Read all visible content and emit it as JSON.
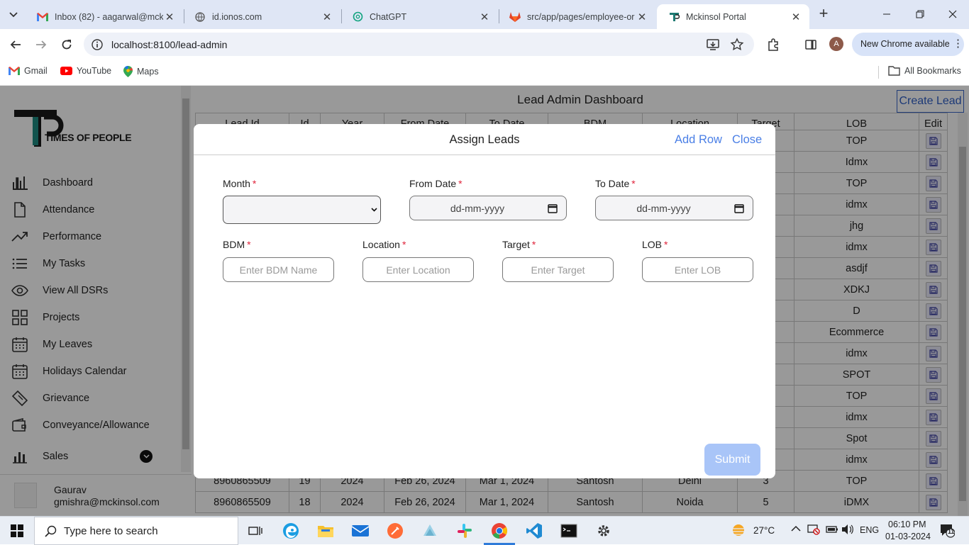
{
  "browser": {
    "tabs": [
      {
        "title": "Inbox (82) - aagarwal@mckin",
        "icon": "gmail-icon"
      },
      {
        "title": "id.ionos.com",
        "icon": "globe-icon"
      },
      {
        "title": "ChatGPT",
        "icon": "chatgpt-icon"
      },
      {
        "title": "src/app/pages/employee-or",
        "icon": "gitlab-icon"
      },
      {
        "title": "Mckinsol Portal",
        "icon": "portal-icon",
        "active": true
      }
    ],
    "url": "localhost:8100/lead-admin",
    "new_chrome": "New Chrome available",
    "profile_initial": "A",
    "bookmarks": [
      "Gmail",
      "YouTube",
      "Maps"
    ],
    "all_bookmarks": "All Bookmarks"
  },
  "sidebar": {
    "logo_text": "TIMES OF PEOPLE",
    "items": [
      {
        "label": "Dashboard",
        "icon": "bar-chart-icon"
      },
      {
        "label": "Attendance",
        "icon": "document-icon"
      },
      {
        "label": "Performance",
        "icon": "trending-up-icon"
      },
      {
        "label": "My Tasks",
        "icon": "list-icon"
      },
      {
        "label": "View All DSRs",
        "icon": "eye-icon"
      },
      {
        "label": "Projects",
        "icon": "grid-icon"
      },
      {
        "label": "My Leaves",
        "icon": "calendar-icon"
      },
      {
        "label": "Holidays Calendar",
        "icon": "calendar-icon"
      },
      {
        "label": "Grievance",
        "icon": "ticket-icon"
      },
      {
        "label": "Conveyance/Allowance",
        "icon": "wallet-icon"
      },
      {
        "label": "Sales",
        "icon": "stats-icon"
      }
    ],
    "user_name": "Gaurav",
    "user_email": "gmishra@mckinsol.com"
  },
  "main": {
    "title": "Lead Admin Dashboard",
    "create_lead": "Create Lead",
    "table": {
      "columns": [
        "Lead Id",
        "Id",
        "Year",
        "From Date",
        "To Date",
        "BDM",
        "Location",
        "Target",
        "LOB",
        "Edit"
      ],
      "lob_column": [
        "TOP",
        "Idmx",
        "TOP",
        "idmx",
        "jhg",
        "idmx",
        "asdjf",
        "XDKJ",
        "D",
        "Ecommerce",
        "idmx",
        "SPOT",
        "TOP",
        "idmx",
        "Spot",
        "idmx"
      ],
      "visible_rows": [
        {
          "lead_id": "8960865509",
          "id": "19",
          "year": "2024",
          "from": "Feb 26, 2024",
          "to": "Mar 1, 2024",
          "bdm": "Santosh",
          "location": "Delhi",
          "target": "3",
          "lob": "TOP"
        },
        {
          "lead_id": "8960865509",
          "id": "18",
          "year": "2024",
          "from": "Feb 26, 2024",
          "to": "Mar 1, 2024",
          "bdm": "Santosh",
          "location": "Noida",
          "target": "5",
          "lob": "iDMX"
        }
      ]
    }
  },
  "modal": {
    "title": "Assign Leads",
    "add_row": "Add Row",
    "close": "Close",
    "fields": {
      "month": {
        "label": "Month",
        "value": ""
      },
      "from_date": {
        "label": "From Date",
        "placeholder": "dd-mm-yyyy"
      },
      "to_date": {
        "label": "To Date",
        "placeholder": "dd-mm-yyyy"
      },
      "bdm": {
        "label": "BDM",
        "placeholder": "Enter BDM Name"
      },
      "location": {
        "label": "Location",
        "placeholder": "Enter Location"
      },
      "target": {
        "label": "Target",
        "placeholder": "Enter Target"
      },
      "lob": {
        "label": "LOB",
        "placeholder": "Enter LOB"
      }
    },
    "required_mark": "*",
    "submit": "Submit"
  },
  "taskbar": {
    "search_placeholder": "Type here to search",
    "weather": "27°C",
    "language": "ENG",
    "time": "06:10 PM",
    "date": "01-03-2024",
    "notification_count": "11"
  },
  "colors": {
    "accent": "#4a7fe6",
    "required": "#e0243b",
    "submit_disabled": "#a9c5f8"
  }
}
